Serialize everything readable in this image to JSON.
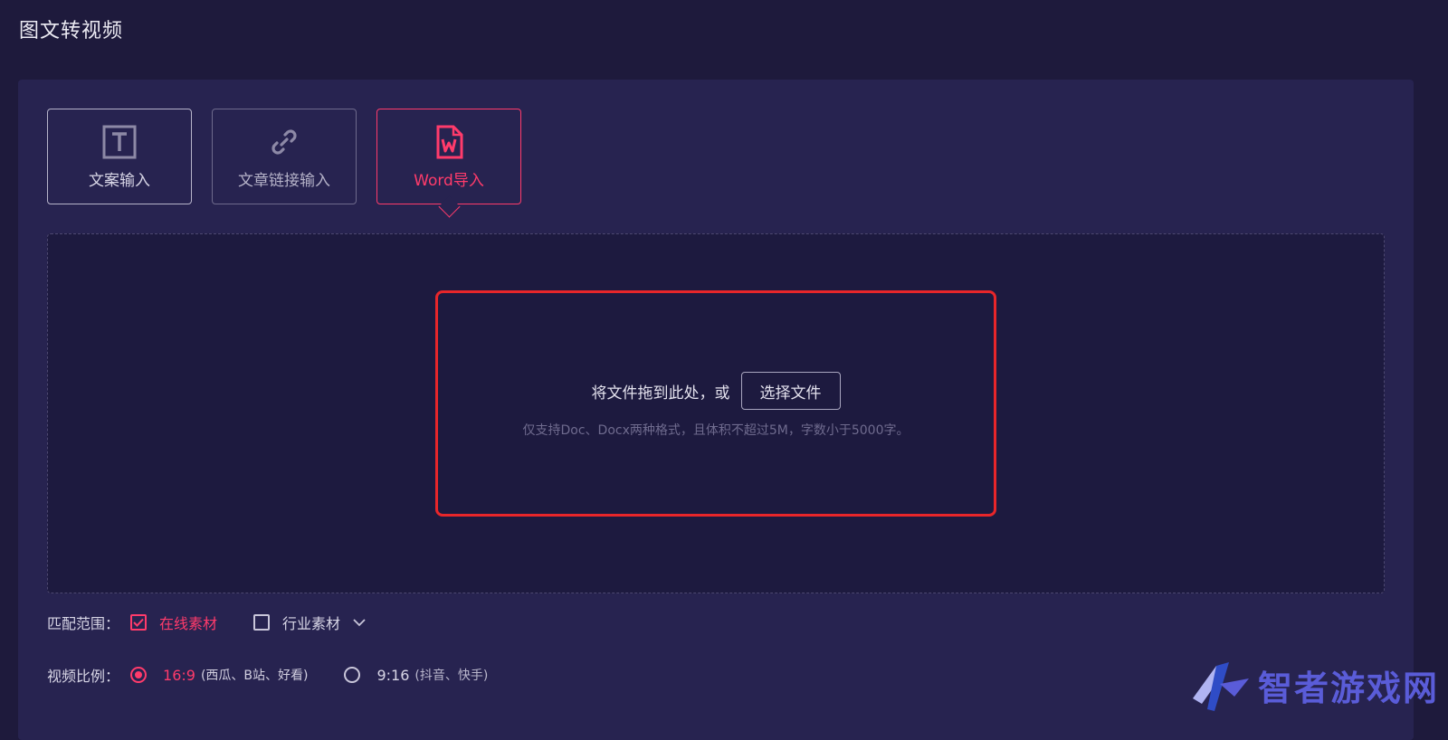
{
  "page": {
    "title": "图文转视频"
  },
  "tabs": [
    {
      "label": "文案输入",
      "icon": "text-box-icon",
      "state": "default"
    },
    {
      "label": "文章链接输入",
      "icon": "link-icon",
      "state": "default"
    },
    {
      "label": "Word导入",
      "icon": "word-file-icon",
      "state": "active"
    }
  ],
  "dropzone": {
    "drag_text": "将文件拖到此处，或",
    "choose_label": "选择文件",
    "hint": "仅支持Doc、Docx两种格式，且体积不超过5M，字数小于5000字。"
  },
  "match_range": {
    "label": "匹配范围：",
    "options": [
      {
        "label": "在线素材",
        "checked": true
      },
      {
        "label": "行业素材",
        "checked": false
      }
    ]
  },
  "aspect": {
    "label": "视频比例：",
    "options": [
      {
        "label": "16:9",
        "sub": "(西瓜、B站、好看)",
        "selected": true
      },
      {
        "label": "9:16",
        "sub": "(抖音、快手)",
        "selected": false
      }
    ]
  },
  "watermark": {
    "text": "智者游戏网"
  },
  "colors": {
    "accent": "#ff3b6b",
    "highlight": "#e8262a",
    "panel": "#272350",
    "background": "#1e1a3c"
  }
}
